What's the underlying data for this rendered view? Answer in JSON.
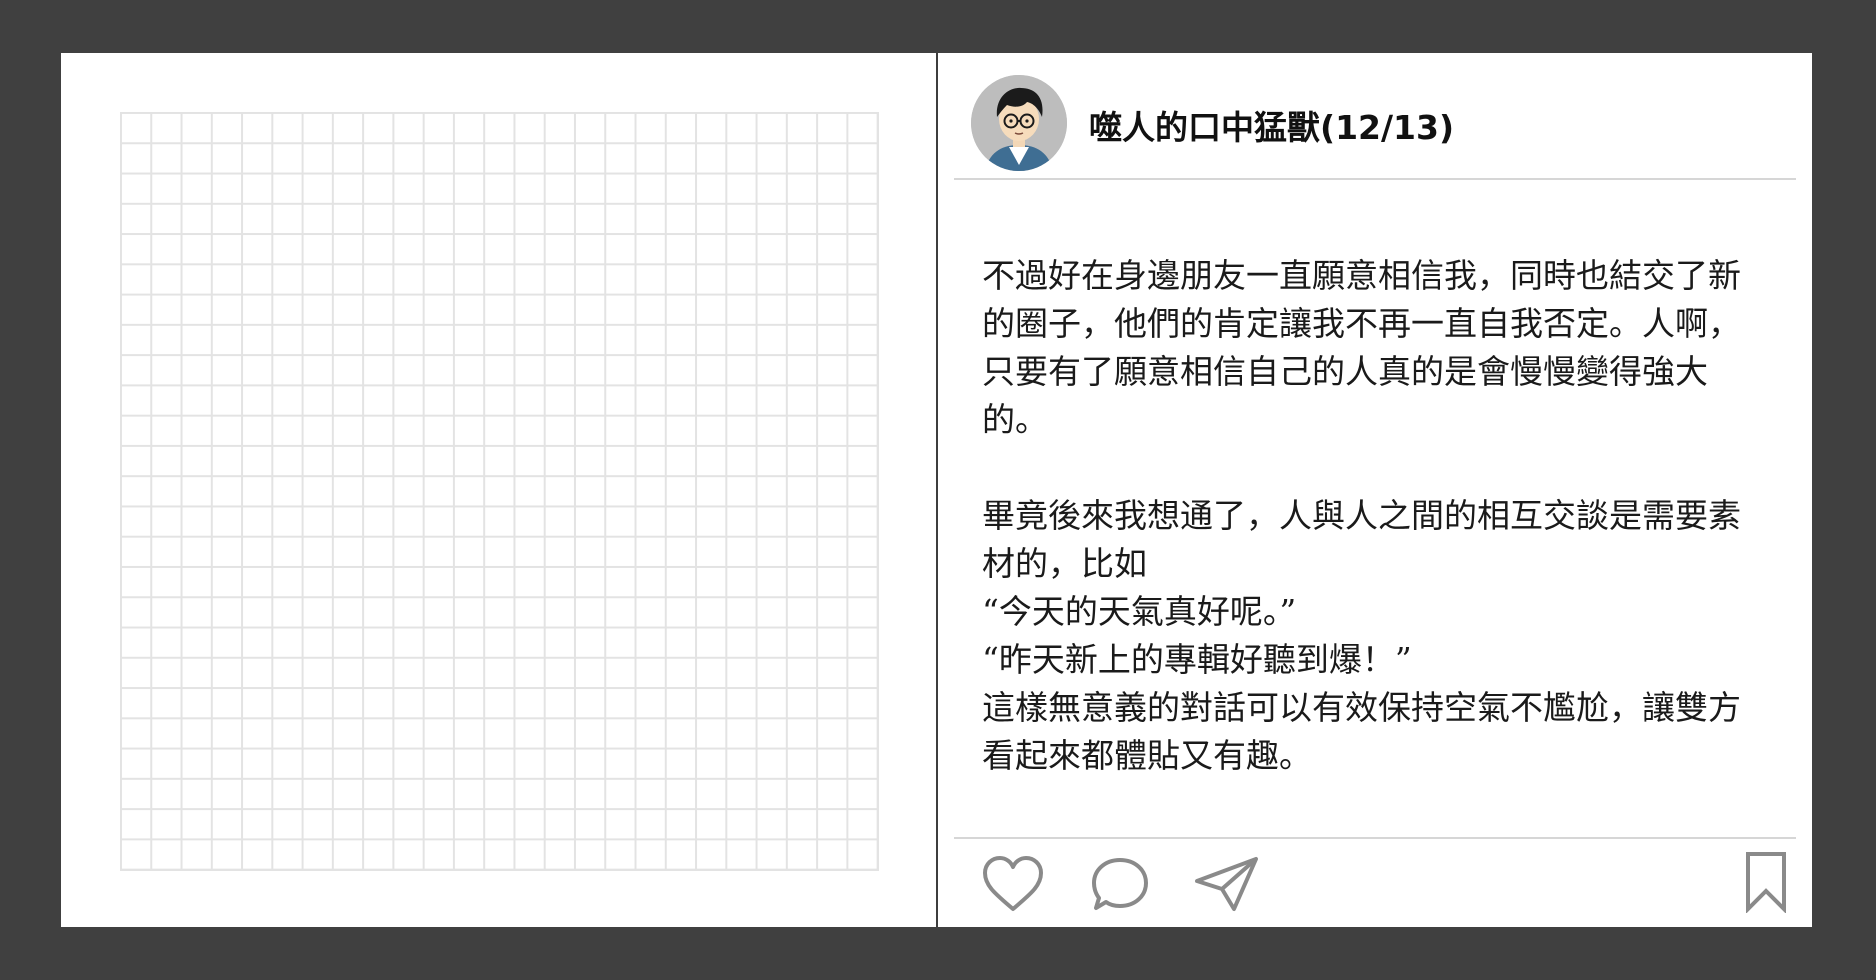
{
  "post": {
    "username": "噬人的口中猛獸(12/13)",
    "paragraphs": [
      "不過好在身邊朋友一直願意相信我，同時也結交了新的圈子，他們的肯定讓我不再一直自我否定。人啊，只要有了願意相信自己的人真的是會慢慢變得強大的。",
      "",
      "畢竟後來我想通了，人與人之間的相互交談是需要素材的，比如",
      "“今天的天氣真好呢。”",
      "“昨天新上的專輯好聽到爆！”",
      "這樣無意義的對話可以有效保持空氣不尷尬，讓雙方看起來都體貼又有趣。"
    ]
  },
  "icons": {
    "avatar": "avatar-illustration",
    "like": "heart-icon",
    "comment": "comment-bubble-icon",
    "share": "paper-plane-icon",
    "save": "bookmark-icon"
  },
  "colors": {
    "background": "#404040",
    "card": "#ffffff",
    "grid_line": "#e3e3e3",
    "divider": "#3d3d3d",
    "rule": "#d6d6d6",
    "icon_stroke": "#8a8a8a",
    "text": "#1a1a1a"
  }
}
